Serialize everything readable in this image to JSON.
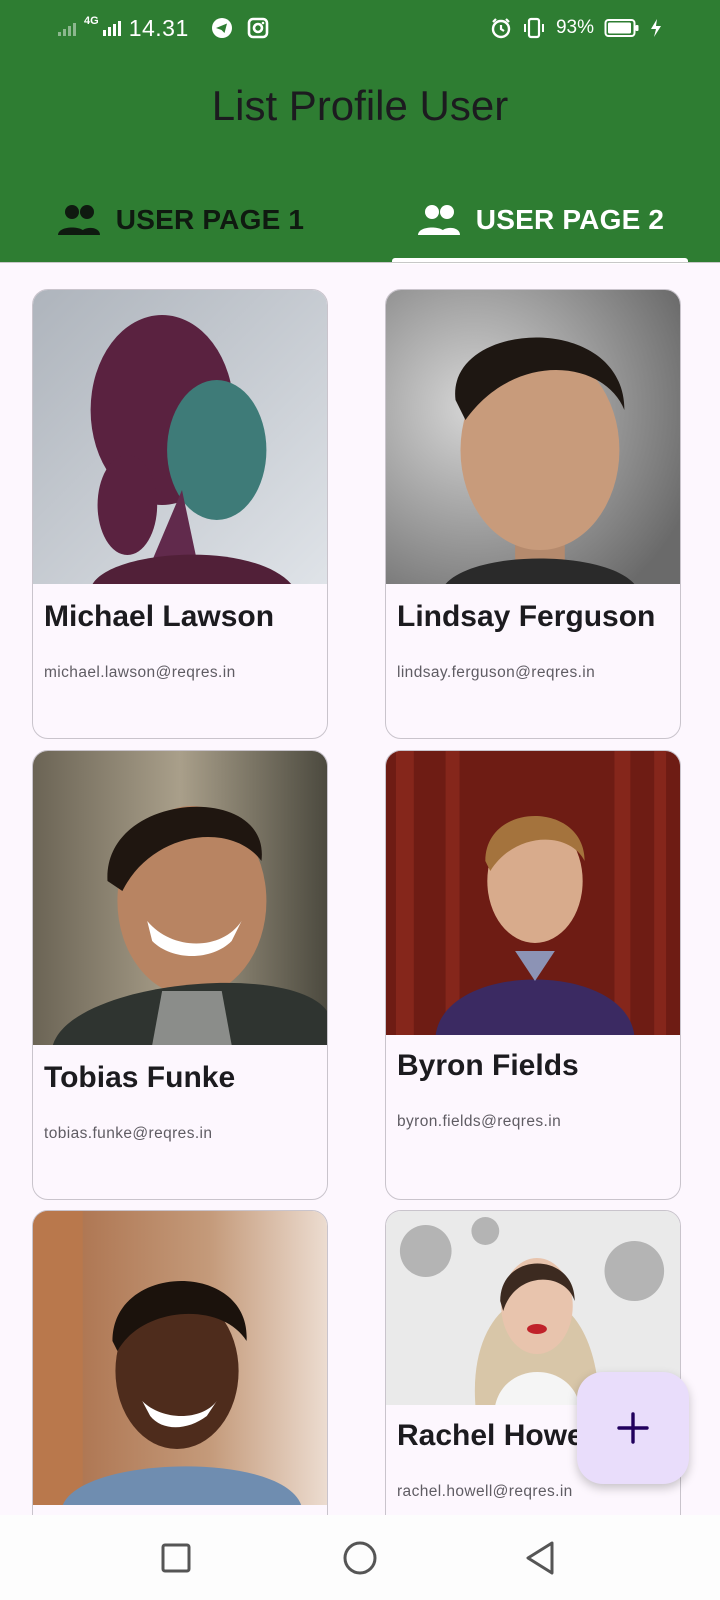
{
  "status_bar": {
    "network": "4G",
    "time": "14.31",
    "battery_percent": "93%",
    "icons": [
      "signal-icon",
      "telegram-icon",
      "instagram-icon",
      "alarm-icon",
      "vibrate-icon",
      "battery-icon",
      "charging-icon"
    ]
  },
  "app_bar": {
    "title": "List Profile User",
    "background_color": "#2e7d32"
  },
  "tabs": [
    {
      "label": "USER PAGE 1",
      "icon": "people-icon",
      "selected": false
    },
    {
      "label": "USER PAGE 2",
      "icon": "people-icon",
      "selected": true
    }
  ],
  "users": [
    {
      "name": "Michael Lawson",
      "email": "michael.lawson@reqres.in",
      "photo": "avatar-photo"
    },
    {
      "name": "Lindsay Ferguson",
      "email": "lindsay.ferguson@reqres.in",
      "photo": "avatar-photo"
    },
    {
      "name": "Tobias Funke",
      "email": "tobias.funke@reqres.in",
      "photo": "avatar-photo"
    },
    {
      "name": "Byron Fields",
      "email": "byron.fields@reqres.in",
      "photo": "avatar-photo"
    },
    {
      "name": "",
      "email": "",
      "photo": "avatar-photo"
    },
    {
      "name": "Rachel Howell",
      "email": "rachel.howell@reqres.in",
      "photo": "avatar-photo"
    }
  ],
  "fab": {
    "icon": "plus-icon",
    "color": "#e9ddfb"
  },
  "nav_bar": {
    "icons": [
      "recents-icon",
      "home-icon",
      "back-icon"
    ]
  }
}
